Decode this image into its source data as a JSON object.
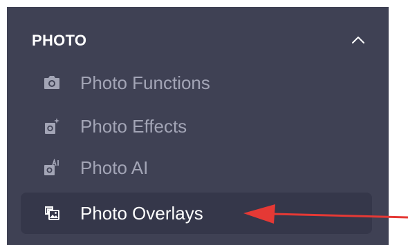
{
  "section": {
    "title": "PHOTO",
    "collapse_icon": "chevron-up-icon"
  },
  "menu": {
    "items": [
      {
        "label": "Photo Functions",
        "icon": "camera-icon",
        "active": false
      },
      {
        "label": "Photo Effects",
        "icon": "camera-sparkle-icon",
        "active": false
      },
      {
        "label": "Photo AI",
        "icon": "camera-ai-icon",
        "active": false
      },
      {
        "label": "Photo Overlays",
        "icon": "layered-photo-icon",
        "active": true
      }
    ]
  },
  "colors": {
    "panel_background": "#3f4154",
    "active_item_background": "#35374a",
    "inactive_text": "#a3a5b6",
    "active_text": "#ffffff",
    "annotation_arrow": "#e53935"
  }
}
